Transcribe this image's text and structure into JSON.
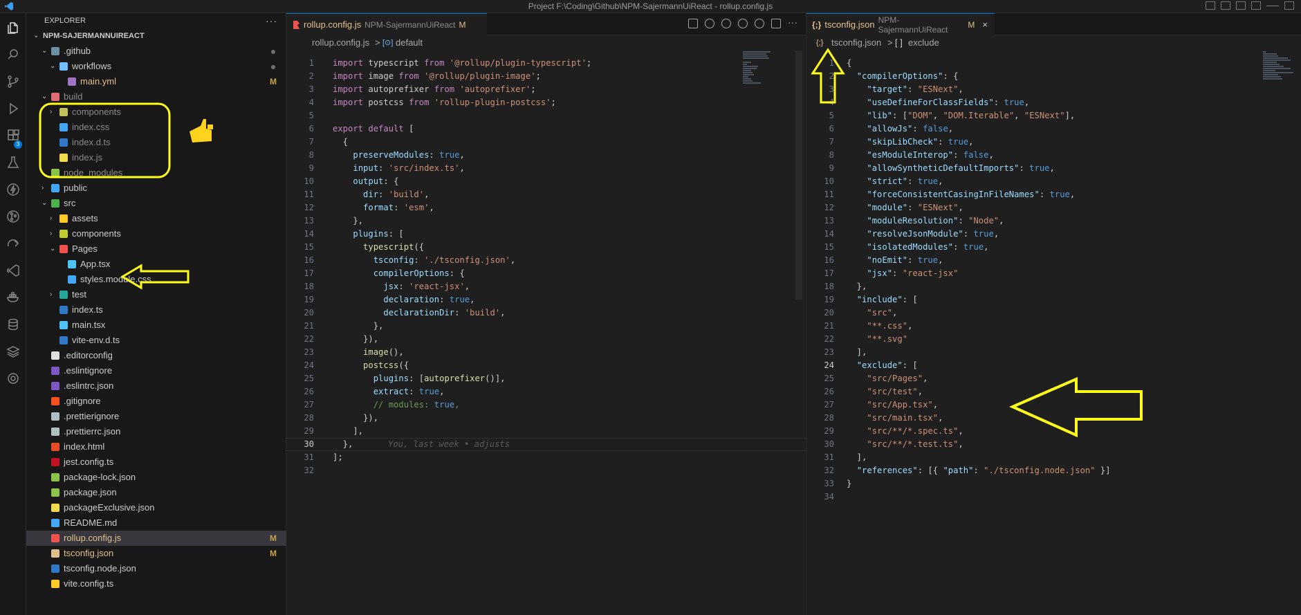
{
  "titlebar": {
    "title": "Project F:\\Coding\\Github\\NPM-SajermannUiReact - rollup.config.js"
  },
  "explorer": {
    "header": "EXPLORER",
    "root": "NPM-SAJERMANNUIREACT",
    "items": [
      {
        "name": ".github",
        "chev": "⌄",
        "level": 1,
        "color": "#cccccc",
        "icon": "#6b8fa3",
        "dot": true
      },
      {
        "name": "workflows",
        "chev": "⌄",
        "level": 2,
        "color": "#cccccc",
        "icon": "#75beff",
        "dot": true
      },
      {
        "name": "main.yml",
        "chev": "",
        "level": 3,
        "color": "#e2c08d",
        "icon": "#a074c4",
        "mark": "M"
      },
      {
        "name": "build",
        "chev": "⌄",
        "level": 1,
        "color": "#8b8b8b",
        "icon": "#e06c75"
      },
      {
        "name": "components",
        "chev": "›",
        "level": 2,
        "color": "#8b8b8b",
        "icon": "#c2c05a"
      },
      {
        "name": "index.css",
        "chev": "",
        "level": 2,
        "color": "#8b8b8b",
        "icon": "#42a5f5"
      },
      {
        "name": "index.d.ts",
        "chev": "",
        "level": 2,
        "color": "#8b8b8b",
        "icon": "#3178c6"
      },
      {
        "name": "index.js",
        "chev": "",
        "level": 2,
        "color": "#8b8b8b",
        "icon": "#f0db4f"
      },
      {
        "name": "node_modules",
        "chev": "›",
        "level": 1,
        "color": "#8b8b8b",
        "icon": "#8bc34a"
      },
      {
        "name": "public",
        "chev": "›",
        "level": 1,
        "color": "#cccccc",
        "icon": "#42a5f5"
      },
      {
        "name": "src",
        "chev": "⌄",
        "level": 1,
        "color": "#cccccc",
        "icon": "#4caf50"
      },
      {
        "name": "assets",
        "chev": "›",
        "level": 2,
        "color": "#cccccc",
        "icon": "#ffca28"
      },
      {
        "name": "components",
        "chev": "›",
        "level": 2,
        "color": "#cccccc",
        "icon": "#c0ca33"
      },
      {
        "name": "Pages",
        "chev": "⌄",
        "level": 2,
        "color": "#cccccc",
        "icon": "#ef5350"
      },
      {
        "name": "App.tsx",
        "chev": "",
        "level": 3,
        "color": "#cccccc",
        "icon": "#4fc3f7"
      },
      {
        "name": "styles.module.css",
        "chev": "",
        "level": 3,
        "color": "#cccccc",
        "icon": "#42a5f5"
      },
      {
        "name": "test",
        "chev": "›",
        "level": 2,
        "color": "#cccccc",
        "icon": "#26a69a"
      },
      {
        "name": "index.ts",
        "chev": "",
        "level": 2,
        "color": "#cccccc",
        "icon": "#3178c6"
      },
      {
        "name": "main.tsx",
        "chev": "",
        "level": 2,
        "color": "#cccccc",
        "icon": "#4fc3f7"
      },
      {
        "name": "vite-env.d.ts",
        "chev": "",
        "level": 2,
        "color": "#cccccc",
        "icon": "#3178c6"
      },
      {
        "name": ".editorconfig",
        "chev": "",
        "level": 1,
        "color": "#cccccc",
        "icon": "#e0e0e0"
      },
      {
        "name": ".eslintignore",
        "chev": "",
        "level": 1,
        "color": "#cccccc",
        "icon": "#7e57c2"
      },
      {
        "name": ".eslintrc.json",
        "chev": "",
        "level": 1,
        "color": "#cccccc",
        "icon": "#7e57c2"
      },
      {
        "name": ".gitignore",
        "chev": "",
        "level": 1,
        "color": "#cccccc",
        "icon": "#f4511e"
      },
      {
        "name": ".prettierignore",
        "chev": "",
        "level": 1,
        "color": "#cccccc",
        "icon": "#b0bec5"
      },
      {
        "name": ".prettierrc.json",
        "chev": "",
        "level": 1,
        "color": "#cccccc",
        "icon": "#b0bec5"
      },
      {
        "name": "index.html",
        "chev": "",
        "level": 1,
        "color": "#cccccc",
        "icon": "#e44d26"
      },
      {
        "name": "jest.config.ts",
        "chev": "",
        "level": 1,
        "color": "#cccccc",
        "icon": "#c21325"
      },
      {
        "name": "package-lock.json",
        "chev": "",
        "level": 1,
        "color": "#cccccc",
        "icon": "#8bc34a"
      },
      {
        "name": "package.json",
        "chev": "",
        "level": 1,
        "color": "#cccccc",
        "icon": "#8bc34a"
      },
      {
        "name": "packageExclusive.json",
        "chev": "",
        "level": 1,
        "color": "#cccccc",
        "icon": "#f0db4f",
        "glyph": "{ }"
      },
      {
        "name": "README.md",
        "chev": "",
        "level": 1,
        "color": "#cccccc",
        "icon": "#42a5f5"
      },
      {
        "name": "rollup.config.js",
        "chev": "",
        "level": 1,
        "color": "#e2c08d",
        "icon": "#ef5350",
        "mark": "M",
        "selected": true
      },
      {
        "name": "tsconfig.json",
        "chev": "",
        "level": 1,
        "color": "#e2c08d",
        "icon": "#e2c08d",
        "mark": "M"
      },
      {
        "name": "tsconfig.node.json",
        "chev": "",
        "level": 1,
        "color": "#cccccc",
        "icon": "#3178c6"
      },
      {
        "name": "vite.config.ts",
        "chev": "",
        "level": 1,
        "color": "#cccccc",
        "icon": "#ffca28"
      }
    ]
  },
  "editor_left": {
    "tab": {
      "name": "rollup.config.js",
      "desc": "NPM-SajermannUiReact",
      "mark": "M"
    },
    "breadcrumb": {
      "file": "rollup.config.js",
      "sep": ">",
      "symbol": "default"
    },
    "blame": "You, last week • adjusts",
    "lines": [
      "import typescript from '@rollup/plugin-typescript';",
      "import image from '@rollup/plugin-image';",
      "import autoprefixer from 'autoprefixer';",
      "import postcss from 'rollup-plugin-postcss';",
      "",
      "export default [",
      "  {",
      "    preserveModules: true,",
      "    input: 'src/index.ts',",
      "    output: {",
      "      dir: 'build',",
      "      format: 'esm',",
      "    },",
      "    plugins: [",
      "      typescript({",
      "        tsconfig: './tsconfig.json',",
      "        compilerOptions: {",
      "          jsx: 'react-jsx',",
      "          declaration: true,",
      "          declarationDir: 'build',",
      "        },",
      "      }),",
      "      image(),",
      "      postcss({",
      "        plugins: [autoprefixer()],",
      "        extract: true,",
      "        // modules: true,",
      "      }),",
      "    ],",
      "  },",
      "];",
      ""
    ]
  },
  "editor_right": {
    "tab": {
      "name": "tsconfig.json",
      "desc": "NPM-SajermannUiReact",
      "mark": "M",
      "close": "×"
    },
    "breadcrumb": {
      "file": "tsconfig.json",
      "sep": ">",
      "symbol": "exclude"
    },
    "lines": [
      "{",
      "  \"compilerOptions\": {",
      "    \"target\": \"ESNext\",",
      "    \"useDefineForClassFields\": true,",
      "    \"lib\": [\"DOM\", \"DOM.Iterable\", \"ESNext\"],",
      "    \"allowJs\": false,",
      "    \"skipLibCheck\": true,",
      "    \"esModuleInterop\": false,",
      "    \"allowSyntheticDefaultImports\": true,",
      "    \"strict\": true,",
      "    \"forceConsistentCasingInFileNames\": true,",
      "    \"module\": \"ESNext\",",
      "    \"moduleResolution\": \"Node\",",
      "    \"resolveJsonModule\": true,",
      "    \"isolatedModules\": true,",
      "    \"noEmit\": true,",
      "    \"jsx\": \"react-jsx\"",
      "  },",
      "  \"include\": [",
      "    \"src\",",
      "    \"**.css\",",
      "    \"**.svg\"",
      "  ],",
      "  \"exclude\": [",
      "    \"src/Pages\",",
      "    \"src/test\",",
      "    \"src/App.tsx\",",
      "    \"src/main.tsx\",",
      "    \"src/**/*.spec.ts\",",
      "    \"src/**/*.test.ts\",",
      "  ],",
      "  \"references\": [{ \"path\": \"./tsconfig.node.json\" }]",
      "}",
      ""
    ]
  },
  "colors": {
    "annotation": "#ffff1a",
    "accent": "#0078d4",
    "modified": "#e2c08d"
  },
  "activity_icons": [
    "files-icon",
    "search-icon",
    "source-control-icon",
    "run-debug-icon",
    "extensions-icon",
    "testing-icon",
    "lightning-icon",
    "git-graph-icon",
    "remote-icon",
    "vscode-icon",
    "docker-icon",
    "database-icon",
    "layers-icon",
    "settings-icon"
  ],
  "activity_badge": "3"
}
